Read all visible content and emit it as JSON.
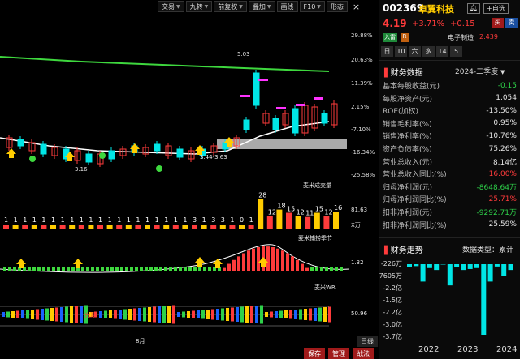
{
  "toolbar": {
    "items": [
      "交易",
      "九转",
      "前复权",
      "叠加",
      "画线",
      "F10",
      "形态"
    ],
    "close": "×"
  },
  "main_chart": {
    "pct_labels": [
      "29.88%",
      "20.63%",
      "11.39%",
      "2.15%",
      "-7.10%",
      "-16.34%",
      "-25.58%"
    ],
    "high_label": "5.03",
    "low_label": "3.16",
    "range_label": "3.44-3.63"
  },
  "volume_panel": {
    "title": "麦米成交量",
    "value": "81.63",
    "unit": "X万",
    "counts": [
      "1",
      "1",
      "1",
      "1",
      "1",
      "1",
      "1",
      "1",
      "1",
      "1",
      "1",
      "1",
      "1",
      "1",
      "1",
      "1",
      "1",
      "1",
      "1",
      "1",
      "3",
      "1",
      "3",
      "3",
      "1",
      "0",
      "1",
      "28",
      "12",
      "18",
      "15",
      "12",
      "11",
      "15",
      "12",
      "16"
    ]
  },
  "season_panel": {
    "title": "麦米捕捞季节",
    "value": "1.32"
  },
  "wr_panel": {
    "title": "麦米WR",
    "value": "50.96",
    "marker": "光源"
  },
  "date_label": "8月",
  "period_label": "日线",
  "bottom_buttons": [
    "保存",
    "管理",
    "战法"
  ],
  "stock": {
    "code": "002369",
    "name": "卓翼科技",
    "price": "4.19",
    "change_pct": "+3.71%",
    "change": "+0.15",
    "alert": "自选",
    "buy": "买",
    "sell": "卖",
    "tag_green": "入雷",
    "tag_r": "R",
    "industry": "电子制造",
    "industry_pct": "2.439",
    "pills": [
      "日",
      "10",
      "六",
      "多",
      "14",
      "5"
    ]
  },
  "finance": {
    "title": "财务数据",
    "period": "2024-二季度",
    "rows": [
      {
        "label": "基本每股收益(元)",
        "value": "-0.15",
        "color": "green"
      },
      {
        "label": "每股净资产(元)",
        "value": "1.054",
        "color": "white"
      },
      {
        "label": "ROE(加权)",
        "value": "-13.50%",
        "color": "white"
      },
      {
        "label": "销售毛利率(%)",
        "value": "0.95%",
        "color": "white"
      },
      {
        "label": "销售净利率(%)",
        "value": "-10.76%",
        "color": "white"
      },
      {
        "label": "资产负债率(%)",
        "value": "75.26%",
        "color": "white"
      },
      {
        "label": "营业总收入(元)",
        "value": "8.14亿",
        "color": "white"
      },
      {
        "label": "营业总收入同比(%)",
        "value": "16.00%",
        "color": "red"
      },
      {
        "label": "归母净利润(元)",
        "value": "-8648.64万",
        "color": "green"
      },
      {
        "label": "归母净利润同比(%)",
        "value": "25.71%",
        "color": "red"
      },
      {
        "label": "扣非净利润(元)",
        "value": "-9292.71万",
        "color": "green"
      },
      {
        "label": "扣非净利润同比(%)",
        "value": "25.59%",
        "color": "white"
      }
    ]
  },
  "trend": {
    "title": "财务走势",
    "type_label": "数据类型：累计",
    "y_labels": [
      "-226万",
      "-7605万",
      "-2.2亿",
      "-1.5亿",
      "-2.2亿",
      "-3.0亿",
      "-3.7亿"
    ],
    "x_labels": [
      "2022",
      "2023",
      "2024"
    ]
  },
  "chart_data": {
    "type": "bar",
    "title": "财务走势",
    "x_labels": [
      "2022",
      "2023",
      "2024"
    ],
    "values": [
      -0.15,
      -0.1,
      -0.9,
      -0.2,
      -0.3,
      -0.02,
      -1.1,
      -0.15,
      -0.3,
      -0.25,
      -0.2,
      -3.7,
      -0.9,
      -0.12,
      -0.6,
      -0.3
    ]
  },
  "colors": {
    "up": "#ff3b3b",
    "down": "#00e6e6",
    "ma": "#3ed83e",
    "accent": "#ffcc00"
  }
}
